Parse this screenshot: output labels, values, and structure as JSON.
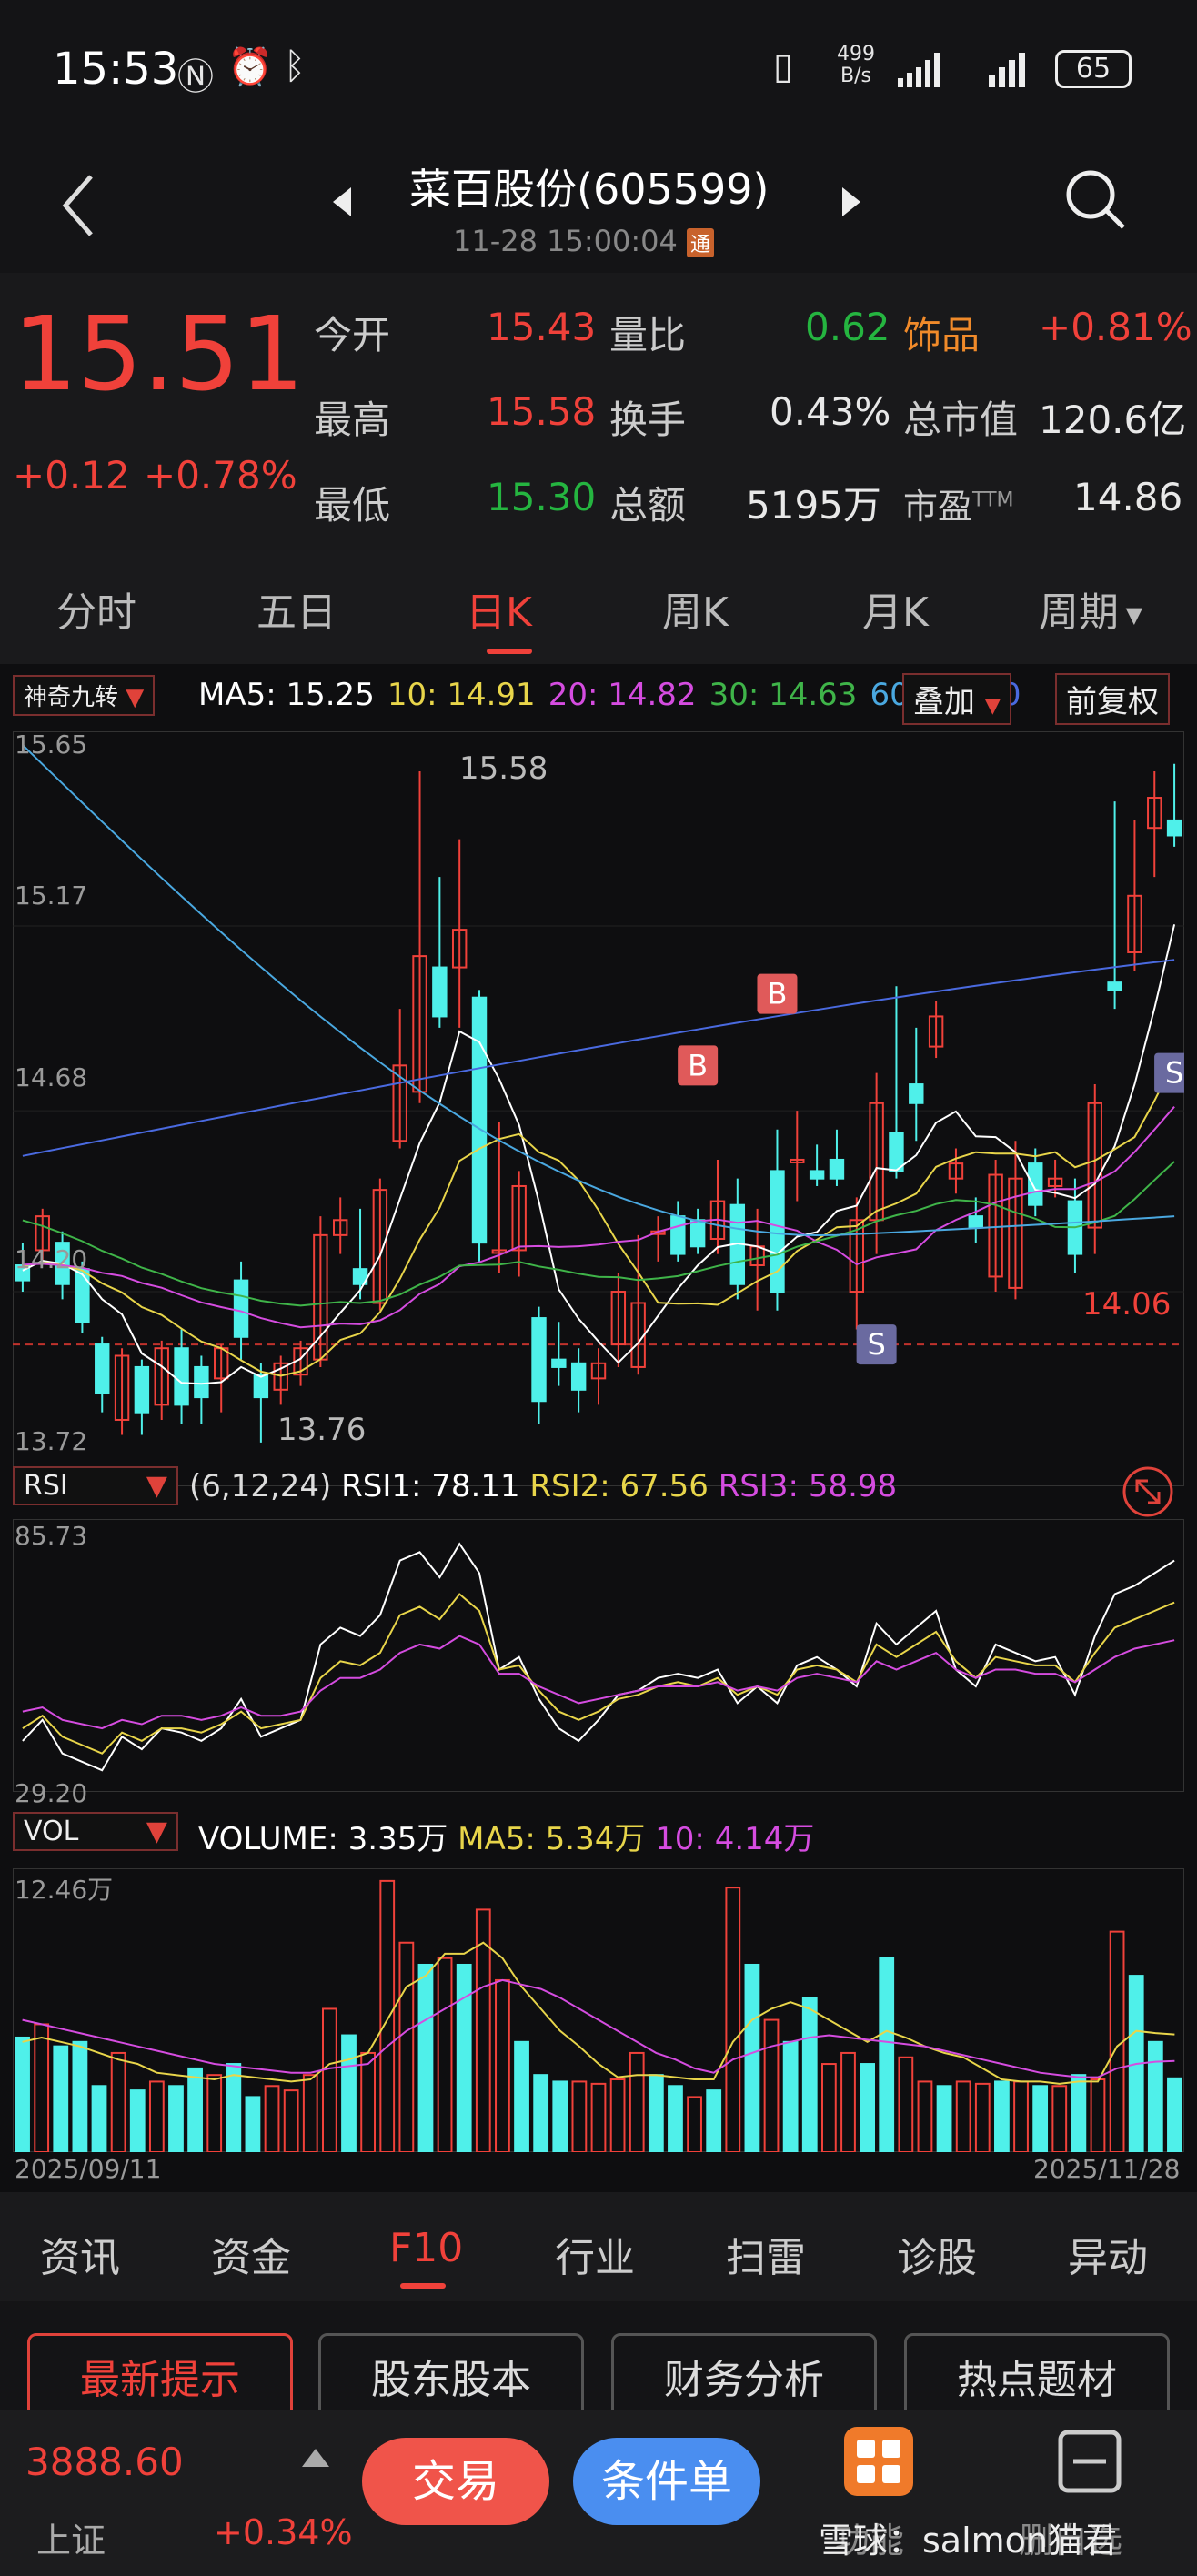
{
  "status_bar": {
    "time": "15:53",
    "net_speed_top": "499",
    "net_speed_bottom": "B/s",
    "battery": "65"
  },
  "header": {
    "title": "菜百股份(605599)",
    "subtitle": "11-28 15:00:04",
    "badge": "通"
  },
  "quote": {
    "price": "15.51",
    "change": "+0.12",
    "change_pct": "+0.78%",
    "labels": {
      "open": "今开",
      "high": "最高",
      "low": "最低",
      "vol_ratio": "量比",
      "turnover": "换手",
      "amount": "总额",
      "sector": "饰品",
      "mkt_cap": "总市值",
      "pe": "市盈",
      "pe_sup": "TTM"
    },
    "values": {
      "open": "15.43",
      "high": "15.58",
      "low": "15.30",
      "vol_ratio": "0.62",
      "turnover": "0.43%",
      "amount": "5195万",
      "sector": "+0.81%",
      "mkt_cap": "120.6亿",
      "pe": "14.86"
    }
  },
  "period_tabs": [
    "分时",
    "五日",
    "日K",
    "周K",
    "月K",
    "周期"
  ],
  "kline": {
    "indicator_select": "神奇九转",
    "ma_legend": [
      {
        "label": "MA5: 15.25",
        "color": "#ffffff"
      },
      {
        "label": "10: 14.91",
        "color": "#e8d54a"
      },
      {
        "label": "20: 14.82",
        "color": "#d54ce0"
      },
      {
        "label": "30: 14.63",
        "color": "#3fb449"
      },
      {
        "label": "60: 1",
        "color": "#4aa8e0"
      },
      {
        "label": "120",
        "color": "#4a6ae0"
      }
    ],
    "overlay_btn": "叠加",
    "adjust_btn": "前复权",
    "y_labels": [
      "15.65",
      "15.17",
      "14.68",
      "14.20",
      "13.72"
    ],
    "high_label": "15.58",
    "low_label": "13.76",
    "ref_line": "14.06",
    "signals": [
      "B",
      "B",
      "S",
      "S"
    ]
  },
  "rsi": {
    "select": "RSI",
    "params": "(6,12,24)",
    "rsi1": "RSI1: 78.11",
    "rsi2": "RSI2: 67.56",
    "rsi3": "RSI3: 58.98",
    "y_top": "85.73",
    "y_bottom": "29.20"
  },
  "vol": {
    "select": "VOL",
    "volume": "VOLUME: 3.35万",
    "ma5": "MA5: 5.34万",
    "ma10": "10: 4.14万",
    "y_top": "12.46万",
    "date_start": "2025/09/11",
    "date_end": "2025/11/28"
  },
  "bottom_tabs": [
    "资讯",
    "资金",
    "F10",
    "行业",
    "扫雷",
    "诊股",
    "异动"
  ],
  "chips": [
    "最新提示",
    "股东股本",
    "财务分析",
    "热点题材"
  ],
  "footer": {
    "index_value": "3888.60",
    "index_name": "上证",
    "index_change": "+0.34%",
    "trade_btn": "交易",
    "cond_btn": "条件单",
    "func_label": "功能",
    "watermark": "雪球：salmon猫君",
    "delete_label": "删自选"
  },
  "colors": {
    "up": "#f0413a",
    "down": "#4ff0ea",
    "bg": "#0e0e10"
  },
  "chart_data": {
    "type": "candlestick",
    "candles": [
      [
        14.27,
        14.23,
        14.33,
        14.2
      ],
      [
        14.31,
        14.4,
        14.42,
        14.28
      ],
      [
        14.33,
        14.22,
        14.36,
        14.18
      ],
      [
        14.26,
        14.12,
        14.28,
        14.09
      ],
      [
        14.06,
        13.93,
        14.08,
        13.88
      ],
      [
        13.86,
        14.03,
        14.05,
        13.82
      ],
      [
        14.0,
        13.88,
        14.02,
        13.82
      ],
      [
        13.9,
        14.05,
        14.07,
        13.86
      ],
      [
        14.05,
        13.9,
        14.1,
        13.85
      ],
      [
        14.0,
        13.92,
        14.03,
        13.85
      ],
      [
        13.97,
        14.05,
        14.06,
        13.88
      ],
      [
        14.23,
        14.08,
        14.28,
        14.02
      ],
      [
        13.98,
        13.92,
        14.01,
        13.8
      ],
      [
        13.94,
        14.01,
        14.03,
        13.9
      ],
      [
        13.98,
        14.05,
        14.07,
        13.95
      ],
      [
        14.02,
        14.35,
        14.4,
        14.0
      ],
      [
        14.35,
        14.39,
        14.45,
        14.3
      ],
      [
        14.26,
        14.22,
        14.42,
        14.18
      ],
      [
        14.17,
        14.47,
        14.5,
        14.15
      ],
      [
        14.6,
        14.8,
        14.95,
        14.58
      ],
      [
        14.73,
        15.09,
        15.58,
        14.7
      ],
      [
        15.06,
        14.93,
        15.3,
        14.9
      ],
      [
        15.06,
        15.16,
        15.4,
        14.9
      ],
      [
        14.98,
        14.33,
        15.0,
        14.28
      ],
      [
        14.31,
        14.31,
        14.65,
        14.25
      ],
      [
        14.31,
        14.48,
        14.52,
        14.24
      ],
      [
        14.13,
        13.91,
        14.16,
        13.85
      ],
      [
        14.02,
        14.0,
        14.12,
        13.95
      ],
      [
        14.01,
        13.94,
        14.05,
        13.88
      ],
      [
        13.97,
        14.01,
        14.05,
        13.9
      ],
      [
        14.06,
        14.2,
        14.25,
        14.0
      ],
      [
        14.0,
        14.17,
        14.35,
        13.98
      ],
      [
        14.36,
        14.36,
        14.4,
        14.28
      ],
      [
        14.4,
        14.3,
        14.44,
        14.28
      ],
      [
        14.39,
        14.32,
        14.42,
        14.3
      ],
      [
        14.34,
        14.44,
        14.55,
        14.3
      ],
      [
        14.43,
        14.22,
        14.5,
        14.18
      ],
      [
        14.27,
        14.32,
        14.42,
        14.15
      ],
      [
        14.52,
        14.2,
        14.63,
        14.15
      ],
      [
        14.55,
        14.55,
        14.68,
        14.44
      ],
      [
        14.52,
        14.5,
        14.59,
        14.48
      ],
      [
        14.55,
        14.5,
        14.63,
        14.48
      ],
      [
        14.2,
        14.39,
        14.45,
        14.1
      ],
      [
        14.39,
        14.7,
        14.78,
        14.3
      ],
      [
        14.62,
        14.52,
        15.01,
        14.5
      ],
      [
        14.75,
        14.7,
        14.9,
        14.6
      ],
      [
        14.85,
        14.93,
        14.97,
        14.82
      ],
      [
        14.5,
        14.54,
        14.58,
        14.46
      ],
      [
        14.4,
        14.37,
        14.45,
        14.33
      ],
      [
        14.24,
        14.51,
        14.55,
        14.2
      ],
      [
        14.21,
        14.5,
        14.6,
        14.18
      ],
      [
        14.54,
        14.43,
        14.58,
        14.4
      ],
      [
        14.48,
        14.5,
        14.55,
        14.45
      ],
      [
        14.44,
        14.3,
        14.5,
        14.25
      ],
      [
        14.37,
        14.7,
        14.75,
        14.3
      ],
      [
        15.02,
        15.0,
        15.5,
        14.95
      ],
      [
        15.1,
        15.25,
        15.45,
        15.05
      ],
      [
        15.43,
        15.51,
        15.58,
        15.3
      ],
      [
        15.45,
        15.41,
        15.6,
        15.38
      ]
    ],
    "ma_series_names": [
      "MA5",
      "MA10",
      "MA20",
      "MA30",
      "MA60"
    ],
    "rsi1": [
      35,
      40,
      32,
      30,
      28,
      36,
      33,
      38,
      37,
      35,
      38,
      45,
      36,
      38,
      40,
      58,
      62,
      60,
      65,
      78,
      80,
      74,
      82,
      75,
      52,
      55,
      45,
      38,
      35,
      40,
      46,
      47,
      50,
      51,
      50,
      52,
      44,
      48,
      44,
      53,
      55,
      52,
      48,
      63,
      58,
      62,
      66,
      52,
      48,
      58,
      56,
      54,
      55,
      46,
      60,
      70,
      72,
      75,
      78
    ],
    "rsi2": [
      38,
      41,
      36,
      34,
      32,
      37,
      35,
      38,
      38,
      37,
      39,
      42,
      38,
      39,
      40,
      50,
      54,
      53,
      56,
      65,
      67,
      64,
      70,
      66,
      52,
      53,
      47,
      42,
      40,
      42,
      45,
      46,
      48,
      49,
      48,
      50,
      46,
      48,
      46,
      52,
      53,
      52,
      49,
      58,
      55,
      58,
      61,
      54,
      50,
      55,
      54,
      53,
      53,
      49,
      56,
      62,
      64,
      66,
      68
    ],
    "rsi3": [
      42,
      43,
      40,
      39,
      38,
      40,
      39,
      41,
      41,
      40,
      41,
      43,
      41,
      41,
      42,
      47,
      50,
      50,
      52,
      56,
      58,
      57,
      60,
      58,
      51,
      51,
      48,
      46,
      44,
      45,
      46,
      47,
      48,
      48,
      48,
      49,
      47,
      48,
      47,
      50,
      51,
      50,
      49,
      54,
      52,
      54,
      56,
      52,
      50,
      52,
      52,
      51,
      51,
      49,
      52,
      55,
      57,
      58,
      59
    ],
    "volume": [
      5.2,
      5.8,
      4.8,
      5.0,
      3.0,
      4.5,
      2.8,
      3.2,
      3.0,
      3.8,
      3.5,
      4.0,
      2.5,
      3.0,
      2.8,
      3.5,
      6.5,
      5.3,
      4.5,
      12.3,
      9.5,
      8.5,
      8.8,
      8.5,
      11.0,
      7.8,
      5.0,
      3.5,
      3.2,
      3.2,
      3.1,
      3.3,
      4.5,
      3.5,
      3.0,
      2.5,
      2.8,
      12.0,
      8.5,
      6.0,
      5.0,
      7.0,
      4.0,
      4.5,
      4.0,
      8.8,
      4.3,
      3.2,
      3.0,
      3.2,
      3.1,
      3.2,
      3.2,
      3.0,
      3.0,
      3.5,
      3.3,
      10.0,
      8.0,
      5.0,
      3.35
    ],
    "vol_ma5": [
      5.0,
      5.2,
      5.0,
      4.8,
      4.5,
      4.2,
      4.0,
      3.6,
      3.5,
      3.4,
      3.3,
      3.5,
      3.4,
      3.3,
      3.2,
      3.3,
      4.0,
      4.2,
      4.5,
      6.0,
      7.5,
      8.0,
      9.0,
      9.0,
      9.5,
      8.8,
      7.5,
      6.5,
      5.5,
      4.8,
      4.0,
      3.4,
      3.5,
      3.5,
      3.4,
      3.3,
      3.3,
      5.0,
      6.0,
      6.5,
      6.8,
      6.5,
      6.0,
      5.5,
      5.0,
      5.5,
      5.2,
      4.8,
      4.5,
      4.3,
      3.8,
      3.3,
      3.2,
      3.2,
      3.1,
      3.2,
      3.2,
      4.8,
      5.5,
      5.4,
      5.34
    ],
    "vol_ma10": [
      6.0,
      5.8,
      5.6,
      5.4,
      5.2,
      5.0,
      4.8,
      4.6,
      4.4,
      4.2,
      4.0,
      3.9,
      3.8,
      3.7,
      3.6,
      3.6,
      3.8,
      3.9,
      4.0,
      4.8,
      5.5,
      6.0,
      6.5,
      7.0,
      7.5,
      7.8,
      7.6,
      7.4,
      7.0,
      6.5,
      6.0,
      5.5,
      5.0,
      4.5,
      4.2,
      3.8,
      3.6,
      4.2,
      4.5,
      4.8,
      5.0,
      5.2,
      5.3,
      5.2,
      5.1,
      5.0,
      4.9,
      4.8,
      4.6,
      4.4,
      4.2,
      4.0,
      3.8,
      3.6,
      3.5,
      3.4,
      3.4,
      3.8,
      4.0,
      4.1,
      4.14
    ]
  }
}
